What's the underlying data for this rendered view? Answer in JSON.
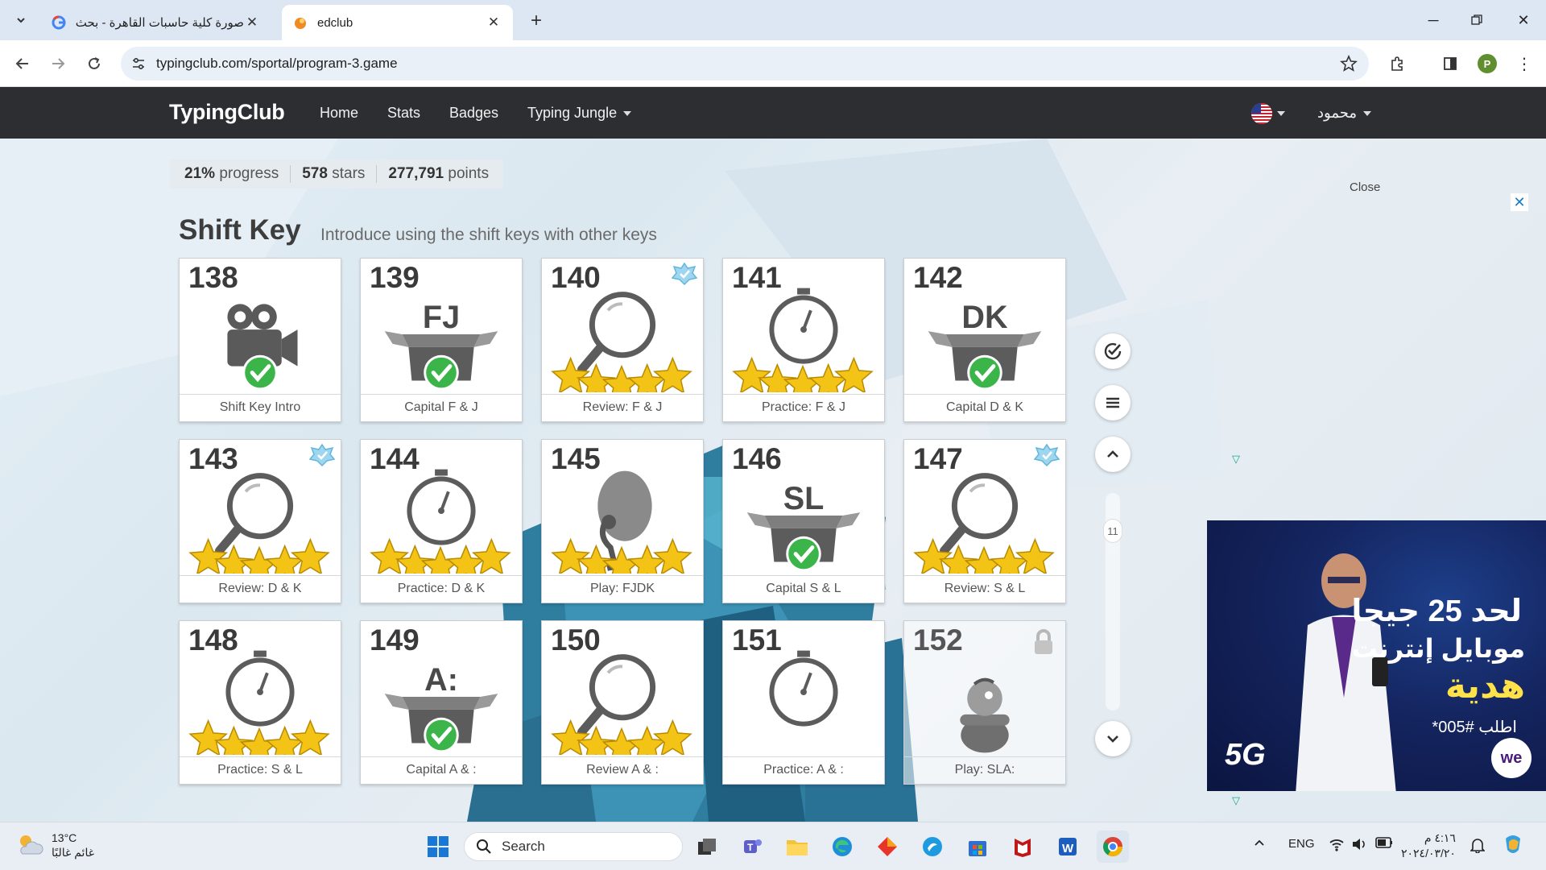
{
  "browser": {
    "tabs": [
      {
        "title": "صورة كلية حاسبات القاهرة - بحث",
        "active": false
      },
      {
        "title": "edclub",
        "active": true
      }
    ],
    "url": "typingclub.com/sportal/program-3.game"
  },
  "site": {
    "logo": "TypingClub",
    "nav": [
      "Home",
      "Stats",
      "Badges",
      "Typing Jungle"
    ],
    "user": "محمود"
  },
  "stats": {
    "progress_value": "21%",
    "progress_label": "progress",
    "stars_value": "578",
    "stars_label": "stars",
    "points_value": "277,791",
    "points_label": "points"
  },
  "section": {
    "title": "Shift Key",
    "subtitle": "Introduce using the shift keys with other keys"
  },
  "lessons": [
    {
      "num": "138",
      "label": "Shift Key Intro",
      "type": "video",
      "done": true
    },
    {
      "num": "139",
      "label": "Capital F & J",
      "type": "box",
      "keys": "FJ",
      "done": true
    },
    {
      "num": "140",
      "label": "Review: F & J",
      "type": "review",
      "stars": 5,
      "badge": true
    },
    {
      "num": "141",
      "label": "Practice: F & J",
      "type": "timer",
      "stars": 5
    },
    {
      "num": "142",
      "label": "Capital D & K",
      "type": "box",
      "keys": "DK",
      "done": true
    },
    {
      "num": "143",
      "label": "Review: D & K",
      "type": "review",
      "stars": 5,
      "badge": true
    },
    {
      "num": "144",
      "label": "Practice: D & K",
      "type": "timer",
      "stars": 5
    },
    {
      "num": "145",
      "label": "Play: FJDK",
      "type": "game",
      "stars": 5
    },
    {
      "num": "146",
      "label": "Capital S & L",
      "type": "box",
      "keys": "SL",
      "done": true
    },
    {
      "num": "147",
      "label": "Review: S & L",
      "type": "review",
      "stars": 5,
      "badge": true
    },
    {
      "num": "148",
      "label": "Practice: S & L",
      "type": "timer",
      "stars": 5
    },
    {
      "num": "149",
      "label": "Capital A & :",
      "type": "box",
      "keys": "A:",
      "done": true
    },
    {
      "num": "150",
      "label": "Review A & :",
      "type": "review",
      "stars": 5
    },
    {
      "num": "151",
      "label": "Practice: A & :",
      "type": "timer",
      "stars": 0
    },
    {
      "num": "152",
      "label": "Play: SLA:",
      "type": "game-locked",
      "locked": true
    }
  ],
  "scroll": {
    "page": "11"
  },
  "ad": {
    "close_label": "Close",
    "line1": "لحد 25 جيجا",
    "line2": "موبايل إنترنت",
    "line3": "هدية",
    "line4": "اطلب #005*",
    "tech": "5G",
    "brand": "we"
  },
  "taskbar": {
    "temperature": "13°C",
    "weather": "غائم غالبًا",
    "search": "Search",
    "lang": "ENG",
    "time": "٤:١٦ م",
    "date": "٢٠٢٤/٠٣/٢٠"
  },
  "colors": {
    "accent": "#2c2e31",
    "check": "#3bb54a",
    "star": "#f3c316"
  }
}
